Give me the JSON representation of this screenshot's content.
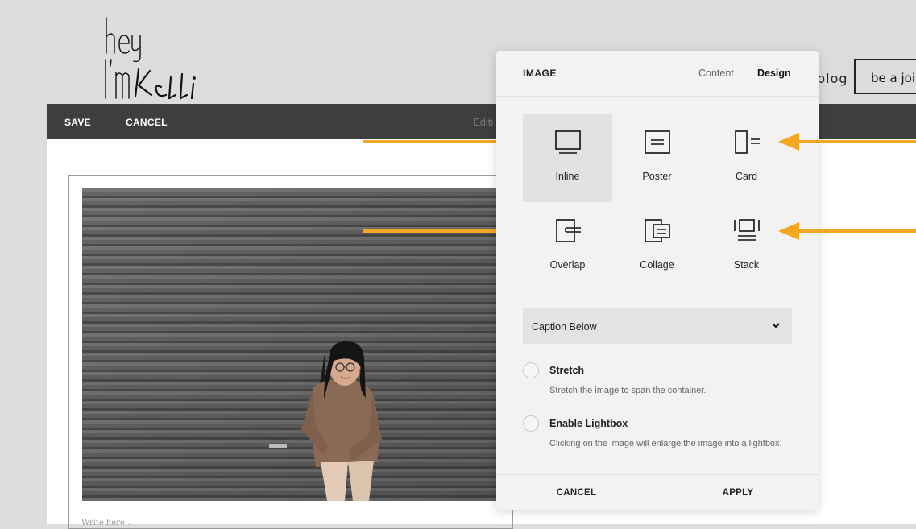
{
  "site": {
    "logo_text": "hey I'm Kelli",
    "nav_blog": "blog",
    "nav_cta": "be a joiner"
  },
  "editor_bar": {
    "save_label": "SAVE",
    "cancel_label": "CANCEL",
    "status_text": "Editi"
  },
  "canvas": {
    "caption_placeholder": "Write here..."
  },
  "panel": {
    "title": "IMAGE",
    "tabs": [
      {
        "label": "Content",
        "active": false
      },
      {
        "label": "Design",
        "active": true
      }
    ],
    "layouts": [
      {
        "label": "Inline",
        "icon": "inline-layout-icon",
        "selected": true
      },
      {
        "label": "Poster",
        "icon": "poster-layout-icon",
        "selected": false
      },
      {
        "label": "Card",
        "icon": "card-layout-icon",
        "selected": false
      },
      {
        "label": "Overlap",
        "icon": "overlap-layout-icon",
        "selected": false
      },
      {
        "label": "Collage",
        "icon": "collage-layout-icon",
        "selected": false
      },
      {
        "label": "Stack",
        "icon": "stack-layout-icon",
        "selected": false
      }
    ],
    "caption_select": {
      "value": "Caption Below"
    },
    "options": [
      {
        "title": "Stretch",
        "description": "Stretch the image to span the container.",
        "checked": false
      },
      {
        "title": "Enable Lightbox",
        "description": "Clicking on the image will enlarge the image into a lightbox.",
        "checked": false
      }
    ],
    "footer": {
      "cancel_label": "CANCEL",
      "apply_label": "APPLY"
    }
  },
  "colors": {
    "arrow": "#f5a623",
    "editor_bar": "#3e3e3e",
    "panel_bg": "#f2f2f2",
    "selected_bg": "#e2e2e2"
  }
}
